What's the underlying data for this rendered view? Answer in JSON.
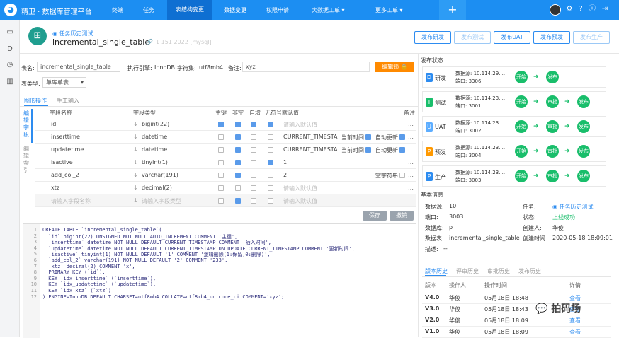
{
  "topnav": {
    "app_title": "精卫 · 数据库管理平台",
    "items": [
      "终端",
      "任务",
      "表结构变更",
      "数据变更",
      "权限申请",
      "大数据工单",
      "更多工单"
    ],
    "plus": "+"
  },
  "header": {
    "tag": "任务历史测试",
    "title": "incremental_single_table",
    "meta": "1 151 2022 [mysql]",
    "buttons": [
      "发布研发",
      "发布测试",
      "发布UAT",
      "发布预发",
      "发布生产"
    ]
  },
  "form": {
    "table_name_label": "表名:",
    "table_name_value": "incremental_single_table",
    "engine_label": "执行引擎:",
    "engine_value": "InnoDB",
    "charset_label": "字符集:",
    "charset_value": "utf8mb4",
    "comment_label": "备注:",
    "comment_value": "xyz",
    "lock_button": "编辑锁",
    "table_type_label": "表类型:",
    "table_type_value": "单库单表"
  },
  "mode_tabs": [
    "图形操作",
    "手工输入"
  ],
  "side_tabs": [
    "编辑字段",
    "编辑索引"
  ],
  "columns_header": [
    "字段名称",
    "字段类型",
    "主键",
    "非空",
    "自增",
    "无符号",
    "默认值",
    "备注"
  ],
  "fields": [
    {
      "name": "id",
      "type": "bigint(22)",
      "default": "请输入默认值",
      "extra1": "",
      "extra2": ""
    },
    {
      "name": "inserttime",
      "type": "datetime",
      "default": "CURRENT_TIMESTA",
      "extra1": "当前时间",
      "extra2": "自动更新"
    },
    {
      "name": "updatetime",
      "type": "datetime",
      "default": "CURRENT_TIMESTA",
      "extra1": "当前时间",
      "extra2": "自动更新"
    },
    {
      "name": "isactive",
      "type": "tinyint(1)",
      "default": "1",
      "extra1": "",
      "extra2": ""
    },
    {
      "name": "add_col_2",
      "type": "varchar(191)",
      "default": "2",
      "extra1": "",
      "extra2": "空字符串"
    },
    {
      "name": "xtz",
      "type": "decimal(2)",
      "default": "请输入默认值",
      "extra1": "",
      "extra2": ""
    },
    {
      "name": "请输入字段名称",
      "type": "请输入字段类型",
      "default": "请输入默认值",
      "extra1": "",
      "extra2": ""
    }
  ],
  "actions": {
    "save": "保存",
    "cancel": "撤销"
  },
  "sql_lines": [
    "CREATE TABLE `incremental_single_table`(",
    "  `id` bigint(22) UNSIGNED NOT NULL AUTO_INCREMENT COMMENT '主键',",
    "  `inserttime` datetime NOT NULL DEFAULT CURRENT_TIMESTAMP COMMENT '插入时间',",
    "  `updatetime` datetime NOT NULL DEFAULT CURRENT_TIMESTAMP ON UPDATE CURRENT_TIMESTAMP COMMENT '更新时间',",
    "  `isactive` tinyint(1) NOT NULL DEFAULT '1' COMMENT '逻辑删除(1:保留,0:删除)',",
    "  `add_col_2` varchar(191) NOT NULL DEFAULT '2' COMMENT '233',",
    "  `xtz` decimal(2) COMMENT 'x',",
    "  PRIMARY KEY (`id`),",
    "  KEY `idx_inserttime` (`inserttime`),",
    "  KEY `idx_updatetime` (`updatetime`),",
    "  KEY `idx_xtz` (`xtz`)",
    ") ENGINE=InnoDB DEFAULT CHARSET=utf8mb4 COLLATE=utf8mb4_unicode_ci COMMENT='xyz';"
  ],
  "publish": {
    "title": "发布状态",
    "envs": [
      {
        "badge": "D",
        "name": "研发",
        "color": "#2d8cf0",
        "ds": "数据源:  10.114.29....",
        "port": "端口:  3306",
        "steps": [
          "开始",
          "发布"
        ]
      },
      {
        "badge": "T",
        "name": "测试",
        "color": "#19be6b",
        "ds": "数据源:  10.114.23....",
        "port": "端口:  3001",
        "steps": [
          "开始",
          "审批",
          "发布"
        ]
      },
      {
        "badge": "U",
        "name": "UAT",
        "color": "#5cadff",
        "ds": "数据源:  10.114.23....",
        "port": "端口:  3002",
        "steps": [
          "开始",
          "审批",
          "发布"
        ]
      },
      {
        "badge": "P",
        "name": "预发",
        "color": "#ff9900",
        "ds": "数据源:  10.114.23....",
        "port": "端口:  3004",
        "steps": [
          "开始",
          "审批",
          "发布"
        ]
      },
      {
        "badge": "P",
        "name": "生产",
        "color": "#2d8cf0",
        "ds": "数据源:  10.114.23....",
        "port": "端口:  3003",
        "steps": [
          "开始",
          "审批",
          "发布"
        ]
      }
    ]
  },
  "basic": {
    "title": "基本信息",
    "ds_label": "数据源:",
    "ds_value": "10",
    "task_label": "任务:",
    "task_value": "任务历史测试",
    "port_label": "端口:",
    "port_value": "3003",
    "status_label": "状态:",
    "status_value": "上线成功",
    "db_label": "数据库:",
    "db_value": "p",
    "creator_label": "创建人:",
    "creator_value": "华俊",
    "table_label": "数据表:",
    "table_value": "incremental_single_table",
    "ctime_label": "创建时间:",
    "ctime_value": "2020-05-18 18:09:01",
    "desc_label": "描述:",
    "desc_value": "--"
  },
  "history": {
    "tabs": [
      "版本历史",
      "评审历史",
      "审批历史",
      "发布历史"
    ],
    "headers": [
      "版本",
      "操作人",
      "操作时间",
      "详情"
    ],
    "rows": [
      {
        "ver": "V4.0",
        "user": "华俊",
        "time": "05月18日 18:48",
        "detail": "查看"
      },
      {
        "ver": "V3.0",
        "user": "华俊",
        "time": "05月18日 18:43",
        "detail": "查看"
      },
      {
        "ver": "V2.0",
        "user": "华俊",
        "time": "05月18日 18:09",
        "detail": "查看"
      },
      {
        "ver": "V1.0",
        "user": "华俊",
        "time": "05月18日 18:09",
        "detail": "查看"
      }
    ]
  },
  "watermark": "拍码场"
}
